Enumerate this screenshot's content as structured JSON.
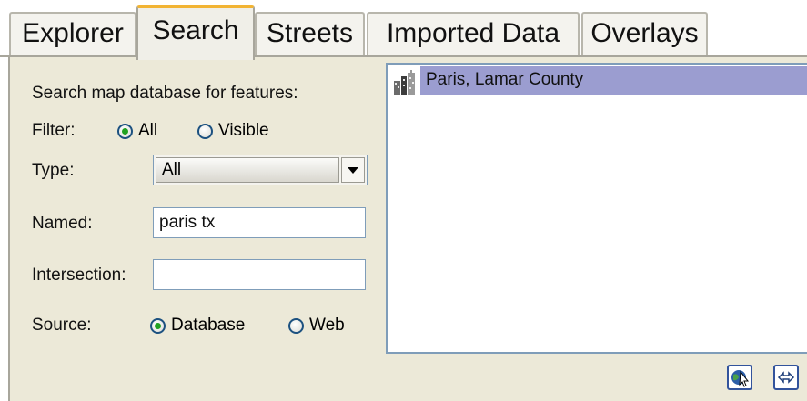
{
  "tabs": [
    {
      "label": "Explorer",
      "active": false
    },
    {
      "label": "Search",
      "active": true
    },
    {
      "label": "Streets",
      "active": false
    },
    {
      "label": "Imported Data",
      "active": false
    },
    {
      "label": "Overlays",
      "active": false
    }
  ],
  "search": {
    "heading": "Search map database for features:",
    "filter": {
      "label": "Filter:",
      "options": [
        {
          "label": "All",
          "selected": true
        },
        {
          "label": "Visible",
          "selected": false
        }
      ]
    },
    "type": {
      "label": "Type:",
      "value": "All"
    },
    "named": {
      "label": "Named:",
      "value": "paris tx"
    },
    "intersection": {
      "label": "Intersection:",
      "value": ""
    },
    "source": {
      "label": "Source:",
      "options": [
        {
          "label": "Database",
          "selected": true
        },
        {
          "label": "Web",
          "selected": false
        }
      ]
    }
  },
  "results": [
    {
      "label": "Paris, Lamar County",
      "icon": "city-buildings-icon",
      "selected": true
    }
  ],
  "toolbar": {
    "buttons": [
      {
        "icon": "globe-cursor-icon"
      },
      {
        "icon": "go-to-result-icon"
      }
    ]
  },
  "colors": {
    "active_tab_accent": "#f2b434",
    "selection": "#9b9dd0",
    "radio_dot": "#21a121",
    "panel": "#ece9d8"
  }
}
